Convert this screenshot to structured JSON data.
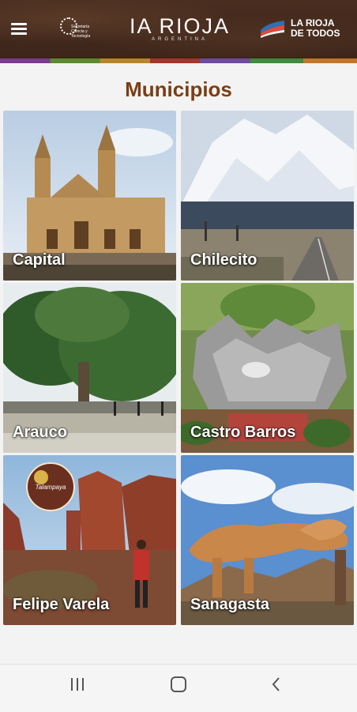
{
  "header": {
    "menu_icon": "hamburger-menu-icon",
    "secretaria_logo_text": "Secretaría Ciencia y Tecnología",
    "brand_word": "IA RIOJA",
    "brand_sub": "ARGENTINA",
    "government_logo_line1": "LA RIOJA",
    "government_logo_line2": "DE TODOS"
  },
  "page": {
    "title": "Municipios"
  },
  "municipios": [
    {
      "name": "Capital"
    },
    {
      "name": "Chilecito"
    },
    {
      "name": "Arauco"
    },
    {
      "name": "Castro Barros"
    },
    {
      "name": "Felipe Varela"
    },
    {
      "name": "Sanagasta"
    }
  ],
  "felipe_badge_text": "Talampaya",
  "colors": {
    "title": "#7a3e14",
    "header_bg": "#3b2418",
    "background": "#f3f3f3"
  },
  "navbar": {
    "recents_icon": "recents-icon",
    "home_icon": "home-icon",
    "back_icon": "back-icon"
  }
}
